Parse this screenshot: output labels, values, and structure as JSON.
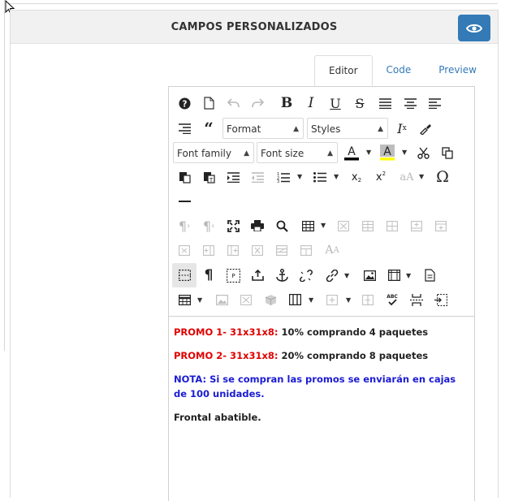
{
  "panel": {
    "title": "CAMPOS PERSONALIZADOS"
  },
  "tabs": [
    {
      "label": "Editor"
    },
    {
      "label": "Code"
    },
    {
      "label": "Preview"
    }
  ],
  "toolbar": {
    "format_label": "Format",
    "styles_label": "Styles",
    "font_family_label": "Font family",
    "font_size_label": "Font size"
  },
  "content": {
    "line1_label": "PROMO 1- 31x31x8:",
    "line1_text": "10% comprando 4 paquetes",
    "line2_label": "PROMO 2- 31x31x8:",
    "line2_text": "20% comprando 8 paquetes",
    "note": "NOTA: Si se compran las promos se enviarán en cajas de 100 unidades.",
    "footer": "Frontal abatible."
  },
  "colors": {
    "accent": "#337ab7",
    "promo": "#e00000",
    "note": "#1b1bd4"
  }
}
